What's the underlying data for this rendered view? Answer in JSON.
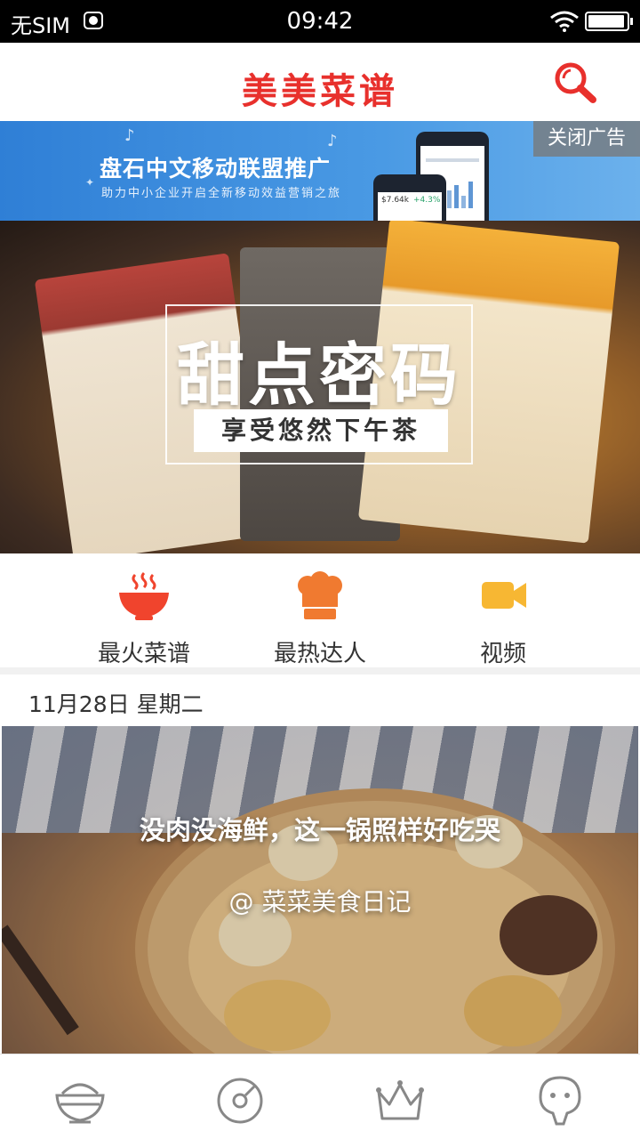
{
  "status_bar": {
    "carrier": "无SIM",
    "time": "09:42"
  },
  "header": {
    "title": "美美菜谱",
    "search_icon": "search-icon"
  },
  "ad": {
    "title": "盘石中文移动联盟推广",
    "subtitle": "助力中小企业开启全新移动效益营销之旅",
    "close_label": "关闭广告",
    "phone_stat_1": "$7.64k",
    "phone_stat_2": "+4.3%"
  },
  "hero": {
    "title": "甜点密码",
    "subtitle": "享受悠然下午茶"
  },
  "categories": [
    {
      "label": "最火菜谱",
      "icon": "bowl-icon",
      "color": "#f0442d"
    },
    {
      "label": "最热达人",
      "icon": "chef-hat-icon",
      "color": "#f07a30"
    },
    {
      "label": "视频",
      "icon": "video-camera-icon",
      "color": "#f7b733"
    }
  ],
  "feed": {
    "date": "11月28日 星期二",
    "feature": {
      "title": "没肉没海鲜，这一锅照样好吃哭",
      "author": "@ 菜菜美食日记"
    }
  },
  "bottom_nav": [
    {
      "icon": "rice-bowl-icon"
    },
    {
      "icon": "compass-icon"
    },
    {
      "icon": "crown-icon"
    },
    {
      "icon": "profile-icon"
    }
  ],
  "colors": {
    "brand_red": "#e8302c",
    "nav_gray": "#888888"
  }
}
